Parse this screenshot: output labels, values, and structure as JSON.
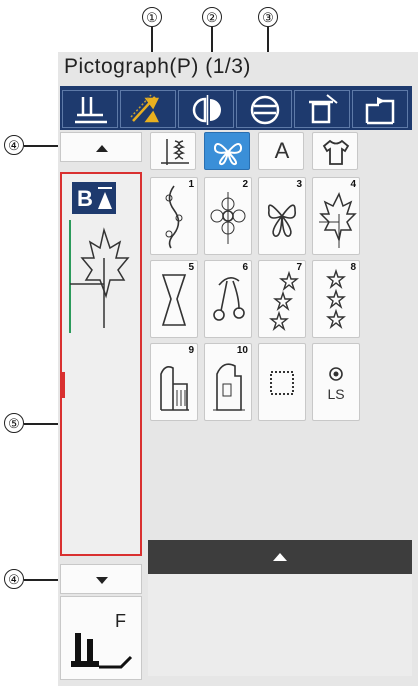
{
  "header": {
    "title": "Pictograph(P)  (1/3)"
  },
  "callouts": [
    "①",
    "②",
    "③",
    "④",
    "⑤",
    "④"
  ],
  "toolbar": {
    "buttons": [
      {
        "icon": "presser-foot-icon"
      },
      {
        "icon": "elongation-icon"
      },
      {
        "icon": "mirror-image-icon"
      },
      {
        "icon": "stitch-width-icon"
      },
      {
        "icon": "delete-icon"
      },
      {
        "icon": "return-icon"
      }
    ]
  },
  "category_tabs": [
    {
      "icon": "satin-stitch-icon",
      "selected": false
    },
    {
      "icon": "pictograph-icon",
      "selected": true
    },
    {
      "label": "A",
      "selected": false
    },
    {
      "icon": "shirt-icon",
      "selected": false
    }
  ],
  "sidebar": {
    "mode_label": "B",
    "page_indicator_icon": "maple-leaf-icon"
  },
  "patterns": [
    {
      "number": "1",
      "icon": "vine-icon"
    },
    {
      "number": "2",
      "icon": "flower-icon"
    },
    {
      "number": "3",
      "icon": "butterfly-icon"
    },
    {
      "number": "4",
      "icon": "maple-leaf-icon"
    },
    {
      "number": "5",
      "icon": "bow-icon"
    },
    {
      "number": "6",
      "icon": "cherries-icon"
    },
    {
      "number": "7",
      "icon": "stars-icon"
    },
    {
      "number": "8",
      "icon": "star-chain-icon"
    },
    {
      "number": "9",
      "icon": "building-icon"
    },
    {
      "number": "10",
      "icon": "house-icon"
    },
    {
      "number": "",
      "icon": "dotted-square-icon"
    },
    {
      "number": "",
      "label": "LS",
      "icon": "ls-dot-icon"
    }
  ],
  "footer": {
    "foot_label": "F"
  },
  "colors": {
    "toolbar_bg": "#1e3a6e",
    "selected_tab": "#3a8fd8",
    "sidebar_border": "#d93030"
  }
}
